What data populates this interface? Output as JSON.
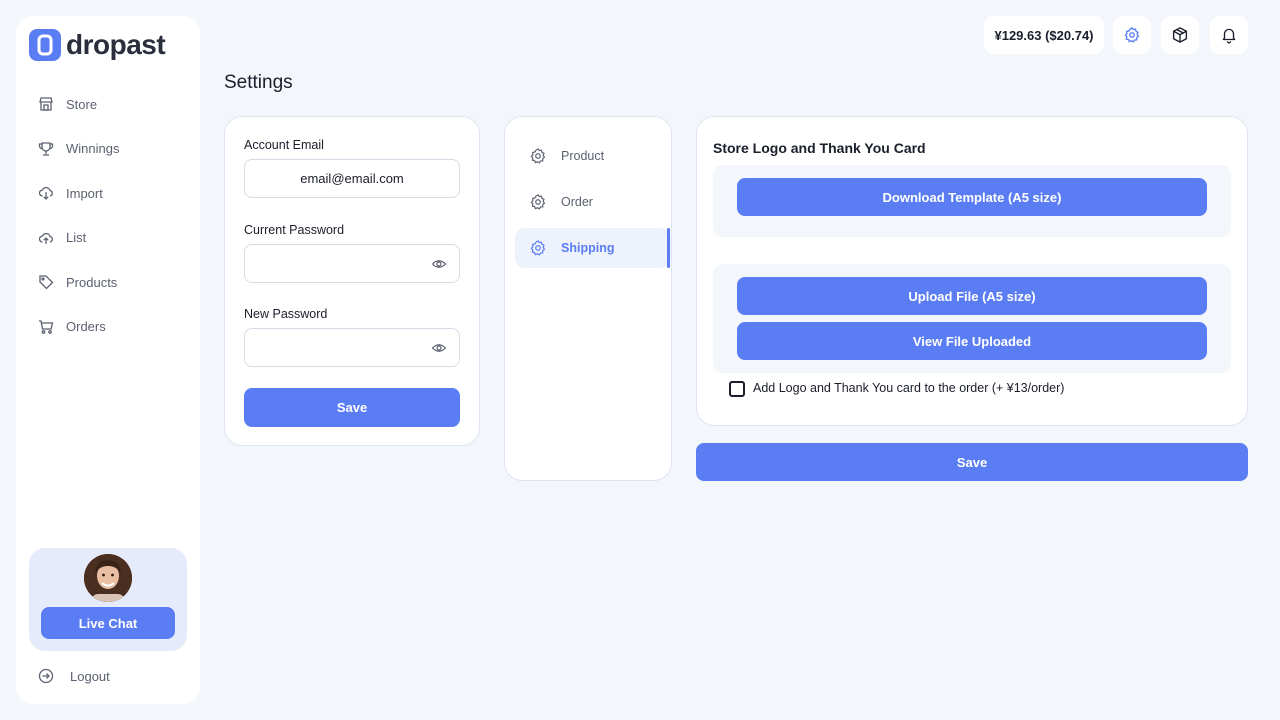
{
  "brand": {
    "name": "dropast",
    "logo_letter": "D"
  },
  "sidebar": {
    "items": [
      {
        "label": "Store",
        "icon": "store-icon"
      },
      {
        "label": "Winnings",
        "icon": "trophy-icon"
      },
      {
        "label": "Import",
        "icon": "cloud-download-icon"
      },
      {
        "label": "List",
        "icon": "cloud-upload-icon"
      },
      {
        "label": "Products",
        "icon": "tag-icon"
      },
      {
        "label": "Orders",
        "icon": "cart-icon"
      }
    ],
    "live_chat_label": "Live Chat",
    "logout_label": "Logout"
  },
  "topbar": {
    "balance": "¥129.63 ($20.74)",
    "icons": [
      "gear-icon",
      "box-icon",
      "bell-icon"
    ]
  },
  "page": {
    "title": "Settings"
  },
  "account_form": {
    "email_label": "Account Email",
    "email_value": "email@email.com",
    "current_password_label": "Current Password",
    "current_password_value": "",
    "new_password_label": "New Password",
    "new_password_value": "",
    "save_label": "Save"
  },
  "settings_tabs": {
    "items": [
      {
        "label": "Product",
        "active": false
      },
      {
        "label": "Order",
        "active": false
      },
      {
        "label": "Shipping",
        "active": true
      }
    ]
  },
  "shipping": {
    "section_title": "Store Logo and Thank You Card",
    "download_template_label": "Download Template (A5 size)",
    "upload_file_label": "Upload File (A5 size)",
    "view_file_label": "View File Uploaded",
    "checkbox_label": "Add Logo and Thank You card to the order (+ ¥13/order)",
    "checkbox_checked": false,
    "save_label": "Save"
  },
  "colors": {
    "accent": "#5b7df3",
    "background": "#f3f6fb",
    "active_tab_bg": "#eef2fc"
  }
}
